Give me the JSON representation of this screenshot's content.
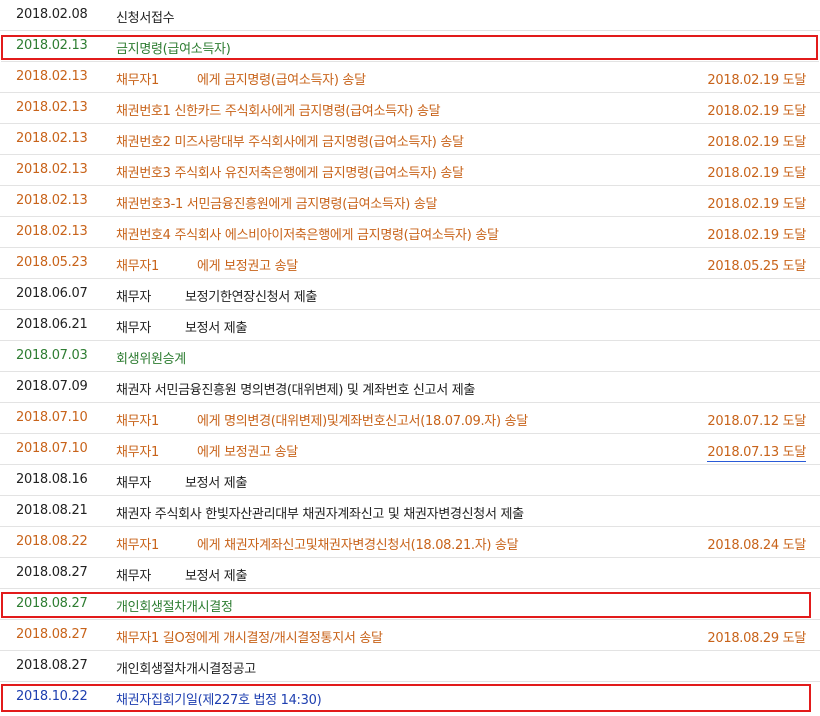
{
  "colors": {
    "black": "#222222",
    "orange": "#c8631a",
    "green": "#2e7d32",
    "blue": "#1e3fb0",
    "highlight": "#e21b1b"
  },
  "rows": [
    {
      "date": "2018.02.08",
      "desc": "신청서접수",
      "deliv": ""
    },
    {
      "date": "2018.02.13",
      "desc": "금지명령(급여소득자)",
      "deliv": ""
    },
    {
      "date": "2018.02.13",
      "desc": "채무자1",
      "desc2": "에게 금지명령(급여소득자) 송달",
      "deliv": "2018.02.19 도달"
    },
    {
      "date": "2018.02.13",
      "desc": "채권번호1 신한카드 주식회사에게 금지명령(급여소득자) 송달",
      "deliv": "2018.02.19 도달"
    },
    {
      "date": "2018.02.13",
      "desc": "채권번호2 미즈사랑대부 주식회사에게 금지명령(급여소득자) 송달",
      "deliv": "2018.02.19 도달"
    },
    {
      "date": "2018.02.13",
      "desc": "채권번호3 주식회사 유진저축은행에게 금지명령(급여소득자) 송달",
      "deliv": "2018.02.19 도달"
    },
    {
      "date": "2018.02.13",
      "desc": "채권번호3-1 서민금융진흥원에게 금지명령(급여소득자) 송달",
      "deliv": "2018.02.19 도달"
    },
    {
      "date": "2018.02.13",
      "desc": "채권번호4 주식회사 에스비아이저축은행에게 금지명령(급여소득자) 송달",
      "deliv": "2018.02.19 도달"
    },
    {
      "date": "2018.05.23",
      "desc": "채무자1",
      "desc2": "에게 보정권고 송달",
      "deliv": "2018.05.25 도달"
    },
    {
      "date": "2018.06.07",
      "desc": "채무자",
      "desc2": "보정기한연장신청서 제출",
      "deliv": ""
    },
    {
      "date": "2018.06.21",
      "desc": "채무자",
      "desc2": "보정서 제출",
      "deliv": ""
    },
    {
      "date": "2018.07.03",
      "desc": "회생위원승계",
      "deliv": ""
    },
    {
      "date": "2018.07.09",
      "desc": "채권자 서민금융진흥원 명의변경(대위변제) 및 계좌번호 신고서 제출",
      "deliv": ""
    },
    {
      "date": "2018.07.10",
      "desc": "채무자1",
      "desc2": "에게 명의변경(대위변제)및계좌번호신고서(18.07.09.자) 송달",
      "deliv": "2018.07.12 도달"
    },
    {
      "date": "2018.07.10",
      "desc": "채무자1",
      "desc2": "에게 보정권고 송달",
      "deliv": "2018.07.13 도달"
    },
    {
      "date": "2018.08.16",
      "desc": "채무자",
      "desc2": "보정서 제출",
      "deliv": ""
    },
    {
      "date": "2018.08.21",
      "desc": "채권자 주식회사 한빛자산관리대부 채권자계좌신고 및 채권자변경신청서 제출",
      "deliv": ""
    },
    {
      "date": "2018.08.22",
      "desc": "채무자1",
      "desc2": "에게 채권자계좌신고및채권자변경신청서(18.08.21.자) 송달",
      "deliv": "2018.08.24 도달"
    },
    {
      "date": "2018.08.27",
      "desc": "채무자",
      "desc2": "보정서 제출",
      "deliv": ""
    },
    {
      "date": "2018.08.27",
      "desc": "개인회생절차개시결정",
      "deliv": ""
    },
    {
      "date": "2018.08.27",
      "desc": "채무자1 길O정에게 개시결정/개시결정통지서 송달",
      "deliv": "2018.08.29 도달"
    },
    {
      "date": "2018.08.27",
      "desc": "개인회생절차개시결정공고",
      "deliv": ""
    },
    {
      "date": "2018.10.22",
      "desc": "채권자집회기일(제227호 법정 14:30)",
      "deliv": ""
    }
  ]
}
